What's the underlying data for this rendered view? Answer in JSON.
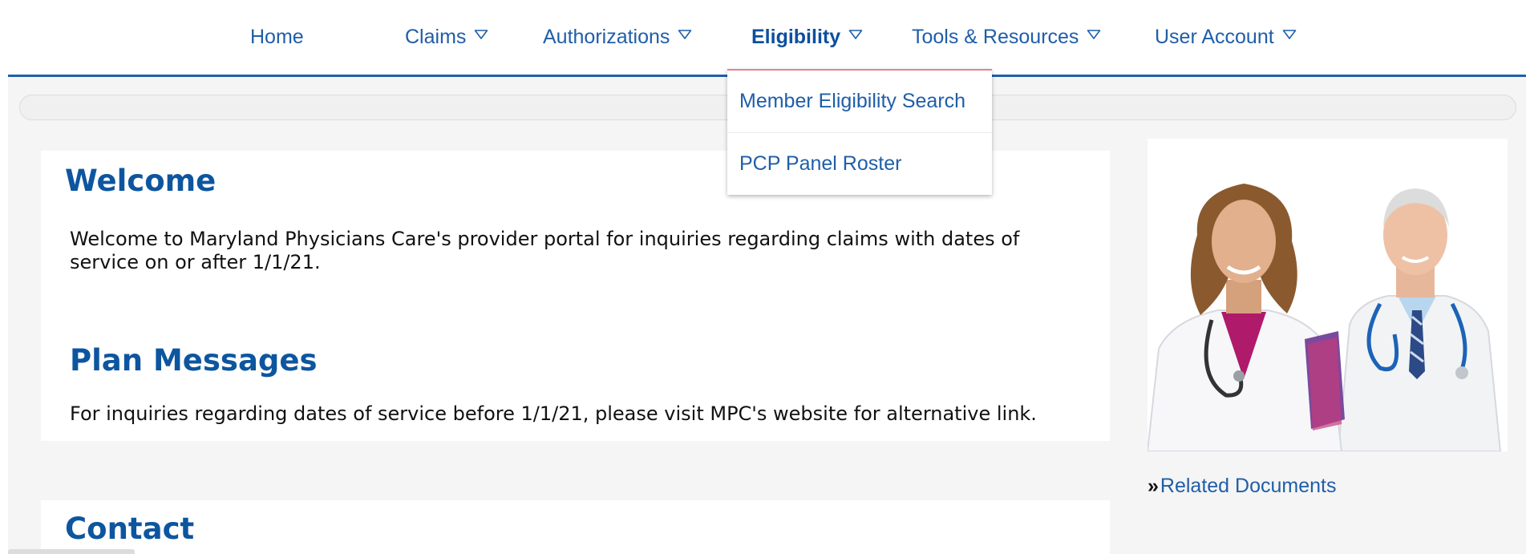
{
  "nav": {
    "items": [
      {
        "label": "Home",
        "has_caret": false
      },
      {
        "label": "Claims",
        "has_caret": true
      },
      {
        "label": "Authorizations",
        "has_caret": true
      },
      {
        "label": "Eligibility",
        "has_caret": true,
        "active": true
      },
      {
        "label": "Tools & Resources",
        "has_caret": true
      },
      {
        "label": "User Account",
        "has_caret": true
      }
    ],
    "caret_icon": "caret-down-outline-icon",
    "underline_color": "#1f5ea8"
  },
  "dropdown": {
    "items": [
      {
        "label": "Member Eligibility Search"
      },
      {
        "label": "PCP Panel Roster"
      }
    ]
  },
  "welcome": {
    "title": "Welcome",
    "text_line1": "Welcome to Maryland Physicians Care's provider portal for inquiries regarding claims with dates of",
    "text_line2": "service on or after 1/1/21."
  },
  "plan_messages": {
    "title": "Plan Messages",
    "text": "For inquiries regarding dates of service before 1/1/21, please visit MPC's website for alternative link."
  },
  "contact": {
    "title": "Contact"
  },
  "sidebar": {
    "image": "doctors-photo",
    "related_prefix": "»",
    "related_label": "Related Documents"
  },
  "colors": {
    "link": "#1f5ea8",
    "heading": "#0d569f",
    "dropdown_accent": "#e8828e",
    "background": "#f5f5f5"
  }
}
